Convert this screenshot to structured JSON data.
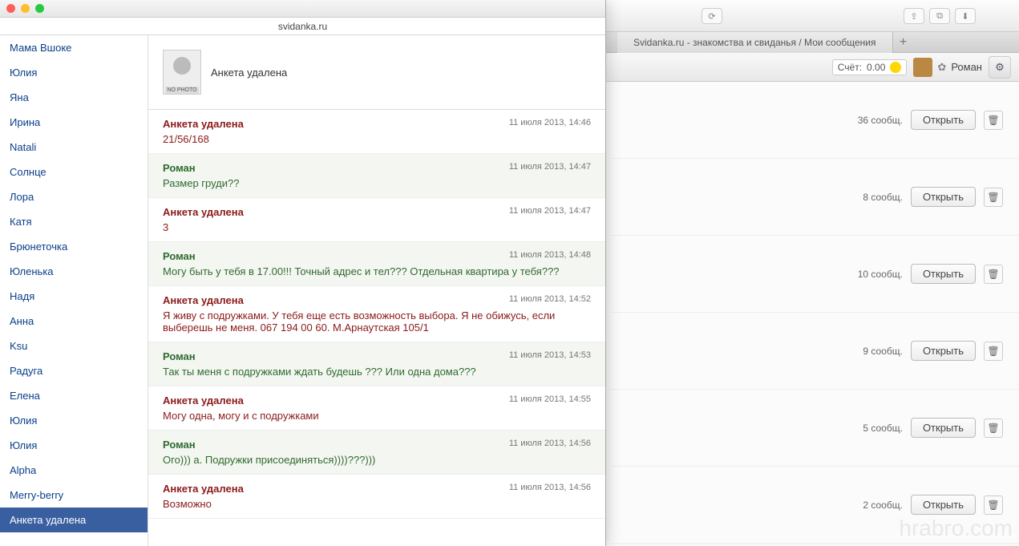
{
  "browser": {
    "tab_title": "Svidanka.ru - знакомства и свиданья / Мои сообщения",
    "reload_glyph": "⟳",
    "share_glyph": "⇪",
    "tabs_glyph": "⧉",
    "download_glyph": "⬇",
    "tab_plus": "+"
  },
  "account": {
    "balance_label": "Счёт:",
    "balance_value": "0.00",
    "username": "Роман",
    "gear_glyph": "⚙"
  },
  "conversations": [
    {
      "count": "36 сообщ.",
      "open": "Открыть"
    },
    {
      "count": "8 сообщ.",
      "open": "Открыть"
    },
    {
      "count": "10 сообщ.",
      "open": "Открыть"
    },
    {
      "count": "9 сообщ.",
      "open": "Открыть"
    },
    {
      "count": "5 сообщ.",
      "open": "Открыть"
    },
    {
      "count": "2 сообщ.",
      "open": "Открыть"
    }
  ],
  "popup": {
    "url": "svidanka.ru",
    "thread_title": "Анкета удалена",
    "no_photo_label": "NO PHOTO"
  },
  "contacts": [
    "Мама Вшоке",
    "Юлия",
    "Яна",
    "Ирина",
    "Natali",
    "Солнце",
    "Лора",
    "Катя",
    "Брюнеточка",
    "Юленька",
    "Надя",
    "Анна",
    "Ksu",
    "Радуга",
    "Елена",
    "Юлия",
    "Юлия",
    "Alpha",
    "Merry-berry",
    "Анкета удалена"
  ],
  "messages": [
    {
      "sender": "Анкета удалена",
      "kind": "a",
      "time": "11 июля 2013, 14:46",
      "body": "21/56/168"
    },
    {
      "sender": "Роман",
      "kind": "b",
      "time": "11 июля 2013, 14:47",
      "body": "Размер груди??"
    },
    {
      "sender": "Анкета удалена",
      "kind": "a",
      "time": "11 июля 2013, 14:47",
      "body": "3"
    },
    {
      "sender": "Роман",
      "kind": "b",
      "time": "11 июля 2013, 14:48",
      "body": "Могу быть у тебя в 17.00!!! Точный адрес и тел??? Отдельная квартира у тебя???"
    },
    {
      "sender": "Анкета удалена",
      "kind": "a",
      "time": "11 июля 2013, 14:52",
      "body": "Я живу с подружками. У тебя еще есть возможность выбора. Я не обижусь, если выберешь не меня. 067 194 00 60. М.Арнаутская 105/1"
    },
    {
      "sender": "Роман",
      "kind": "b",
      "time": "11 июля 2013, 14:53",
      "body": "Так ты меня с подружками ждать будешь ??? Или одна дома???"
    },
    {
      "sender": "Анкета удалена",
      "kind": "a",
      "time": "11 июля 2013, 14:55",
      "body": "Могу одна, могу и с подружками"
    },
    {
      "sender": "Роман",
      "kind": "b",
      "time": "11 июля 2013, 14:56",
      "body": "Ого))) а. Подружки присоединяться))))???)))"
    },
    {
      "sender": "Анкета удалена",
      "kind": "a",
      "time": "11 июля 2013, 14:56",
      "body": "Возможно"
    }
  ],
  "trash_glyph": "🗑",
  "watermark": "hrabro.com"
}
